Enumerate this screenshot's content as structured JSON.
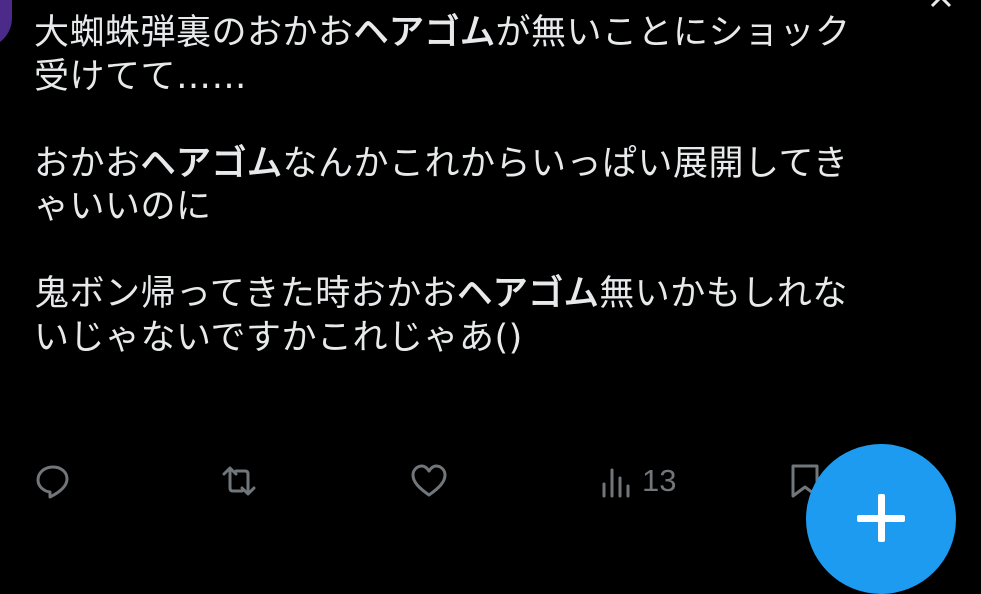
{
  "tweet": {
    "paragraph1": {
      "a": "大蜘蛛弾裏のおかお",
      "b": "ヘアゴム",
      "c": "が無いことにショック\n受けてて……"
    },
    "paragraph2": {
      "a": "おかお",
      "b": "ヘアゴム",
      "c": "なんかこれからいっぱい展開してき\nゃいいのに"
    },
    "paragraph3": {
      "a": "鬼ボン帰ってきた時おかお",
      "b": "ヘアゴム",
      "c": "無いかもしれな\nいじゃないですかこれじゃあ()"
    }
  },
  "actions": {
    "reply_icon": "reply-icon",
    "retweet_icon": "retweet-icon",
    "like_icon": "heart-icon",
    "views_icon": "views-icon",
    "views_count": "13",
    "bookmark_icon": "bookmark-icon"
  },
  "fab": {
    "icon": "plus-icon",
    "color": "#1d9bf0"
  },
  "colors": {
    "background": "#000000",
    "text": "#e7e9ea",
    "muted": "#71767b"
  }
}
